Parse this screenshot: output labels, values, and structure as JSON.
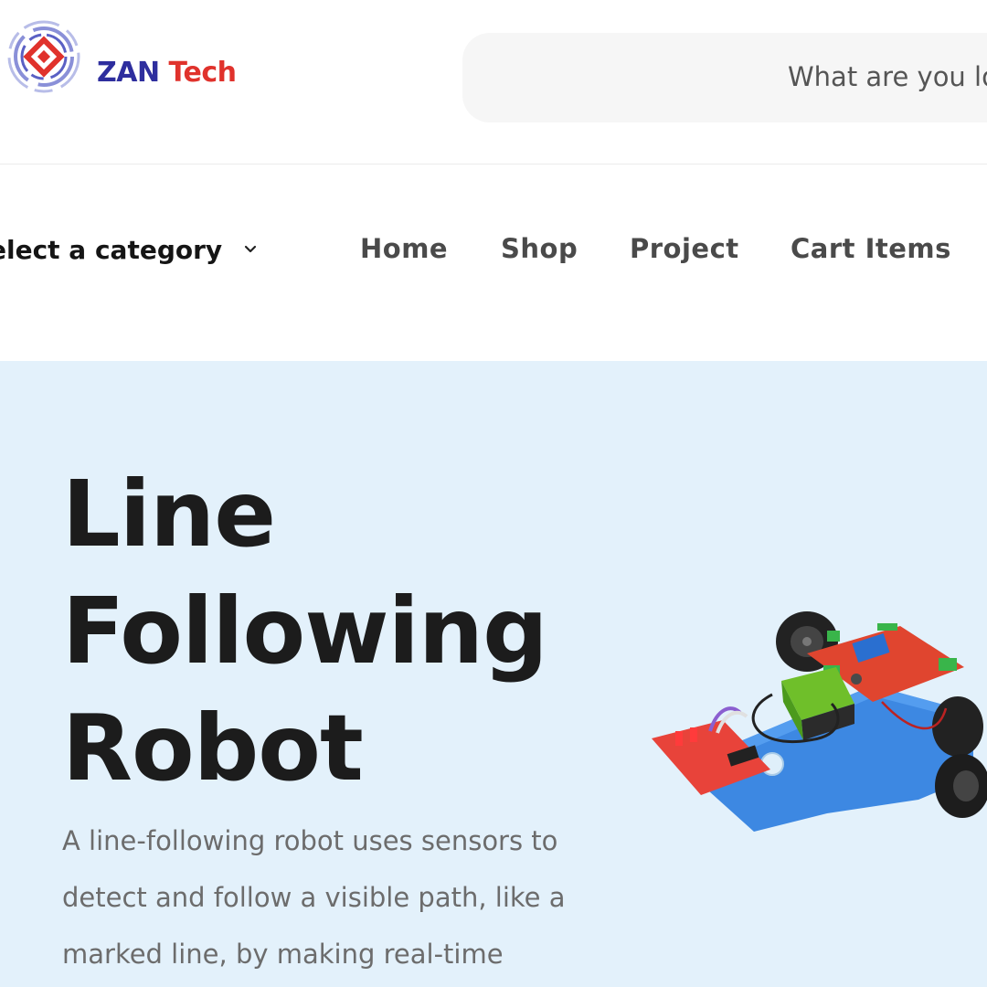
{
  "brand": {
    "name_part1": "ZAN",
    "name_part2": "Tech",
    "colors": {
      "primary": "#2e2e9e",
      "accent": "#e0322c"
    },
    "icon": "zan-tech-logo-icon"
  },
  "search": {
    "placeholder": "What are you lo",
    "value": ""
  },
  "nav": {
    "category_label": "elect a category",
    "category_icon": "chevron-down-icon",
    "links": [
      {
        "label": "Home"
      },
      {
        "label": "Shop"
      },
      {
        "label": "Project"
      },
      {
        "label": "Cart Items"
      }
    ]
  },
  "hero": {
    "title_lines": [
      "Line",
      "Following",
      "Robot"
    ],
    "description": "A line-following robot uses sensors to detect and follow a visible path, like a marked line, by making real-time",
    "image": "line-following-robot-kit",
    "background": "#e3f1fb"
  }
}
